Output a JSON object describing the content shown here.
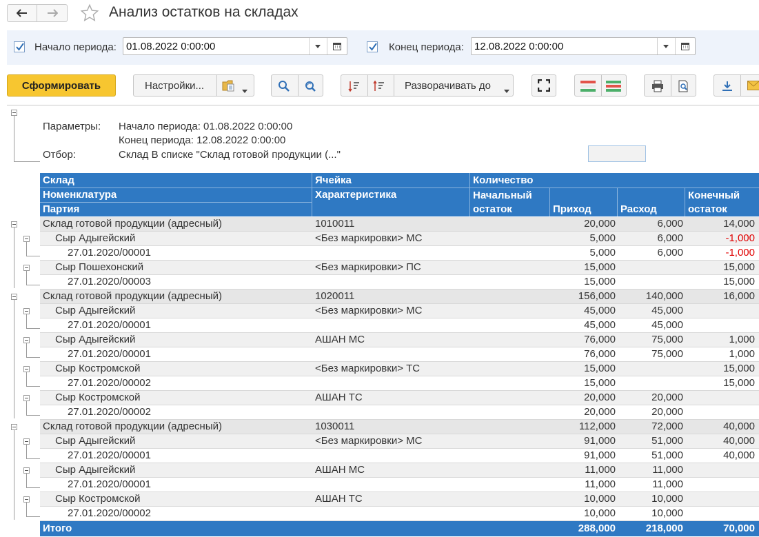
{
  "window": {
    "title": "Анализ остатков на складах"
  },
  "period": {
    "start_label": "Начало периода:",
    "start_value": "01.08.2022  0:00:00",
    "end_label": "Конец периода:",
    "end_value": "12.08.2022  0:00:00"
  },
  "toolbar": {
    "generate_label": "Сформировать",
    "settings_label": "Настройки...",
    "expand_label": "Разворачивать до"
  },
  "params": {
    "params_label": "Параметры:",
    "start_text": "Начало периода: 01.08.2022 0:00:00",
    "end_text": "Конец периода: 12.08.2022 0:00:00",
    "filter_label": "Отбор:",
    "filter_text": "Склад В списке \"Склад готовой продукции (...\""
  },
  "header": {
    "warehouse": "Склад",
    "cell": "Ячейка",
    "quantity": "Количество",
    "item": "Номенклатура",
    "characteristic": "Характеристика",
    "opening_1": "Начальный",
    "opening_2": "остаток",
    "income": "Приход",
    "expense": "Расход",
    "closing_1": "Конечный",
    "closing_2": "остаток",
    "batch": "Партия"
  },
  "rows": [
    {
      "level": 0,
      "name": "Склад готовой продукции (адресный)",
      "char": "1010011",
      "open": "20,000",
      "inc": "6,000",
      "exp": "14,000",
      "close": ""
    },
    {
      "level": 1,
      "name": "Сыр Адыгейский",
      "char": "<Без маркировки> МС",
      "open": "5,000",
      "inc": "6,000",
      "exp": "-1,000",
      "close": "",
      "neg": true
    },
    {
      "level": 2,
      "name": "27.01.2020/00001",
      "char": "",
      "open": "5,000",
      "inc": "6,000",
      "exp": "-1,000",
      "close": "",
      "neg": true
    },
    {
      "level": 1,
      "name": "Сыр Пошехонский",
      "char": "<Без маркировки> ПС",
      "open": "15,000",
      "inc": "",
      "exp": "15,000",
      "close": ""
    },
    {
      "level": 2,
      "name": "27.01.2020/00003",
      "char": "",
      "open": "15,000",
      "inc": "",
      "exp": "15,000",
      "close": ""
    },
    {
      "level": 0,
      "name": "Склад готовой продукции (адресный)",
      "char": "1020011",
      "open": "156,000",
      "inc": "140,000",
      "exp": "16,000",
      "close": ""
    },
    {
      "level": 1,
      "name": "Сыр Адыгейский",
      "char": "<Без маркировки> МС",
      "open": "45,000",
      "inc": "45,000",
      "exp": "",
      "close": ""
    },
    {
      "level": 2,
      "name": "27.01.2020/00001",
      "char": "",
      "open": "45,000",
      "inc": "45,000",
      "exp": "",
      "close": ""
    },
    {
      "level": 1,
      "name": "Сыр Адыгейский",
      "char": "АШАН МС",
      "open": "76,000",
      "inc": "75,000",
      "exp": "1,000",
      "close": ""
    },
    {
      "level": 2,
      "name": "27.01.2020/00001",
      "char": "",
      "open": "76,000",
      "inc": "75,000",
      "exp": "1,000",
      "close": ""
    },
    {
      "level": 1,
      "name": "Сыр Костромской",
      "char": "<Без маркировки> ТС",
      "open": "15,000",
      "inc": "",
      "exp": "15,000",
      "close": ""
    },
    {
      "level": 2,
      "name": "27.01.2020/00002",
      "char": "",
      "open": "15,000",
      "inc": "",
      "exp": "15,000",
      "close": ""
    },
    {
      "level": 1,
      "name": "Сыр Костромской",
      "char": "АШАН ТС",
      "open": "20,000",
      "inc": "20,000",
      "exp": "",
      "close": ""
    },
    {
      "level": 2,
      "name": "27.01.2020/00002",
      "char": "",
      "open": "20,000",
      "inc": "20,000",
      "exp": "",
      "close": ""
    },
    {
      "level": 0,
      "name": "Склад готовой продукции (адресный)",
      "char": "1030011",
      "open": "112,000",
      "inc": "72,000",
      "exp": "40,000",
      "close": ""
    },
    {
      "level": 1,
      "name": "Сыр Адыгейский",
      "char": "<Без маркировки> МС",
      "open": "91,000",
      "inc": "51,000",
      "exp": "40,000",
      "close": ""
    },
    {
      "level": 2,
      "name": "27.01.2020/00001",
      "char": "",
      "open": "91,000",
      "inc": "51,000",
      "exp": "40,000",
      "close": ""
    },
    {
      "level": 1,
      "name": "Сыр Адыгейский",
      "char": "АШАН МС",
      "open": "11,000",
      "inc": "11,000",
      "exp": "",
      "close": ""
    },
    {
      "level": 2,
      "name": "27.01.2020/00001",
      "char": "",
      "open": "11,000",
      "inc": "11,000",
      "exp": "",
      "close": ""
    },
    {
      "level": 1,
      "name": "Сыр Костромской",
      "char": "АШАН ТС",
      "open": "10,000",
      "inc": "10,000",
      "exp": "",
      "close": ""
    },
    {
      "level": 2,
      "name": "27.01.2020/00002",
      "char": "",
      "open": "10,000",
      "inc": "10,000",
      "exp": "",
      "close": ""
    }
  ],
  "total": {
    "label": "Итого",
    "income": "288,000",
    "expense": "218,000",
    "closing": "70,000"
  },
  "colors": {
    "accent": "#2f79c3",
    "primary_button": "#f7c630",
    "negative": "#e00000"
  }
}
